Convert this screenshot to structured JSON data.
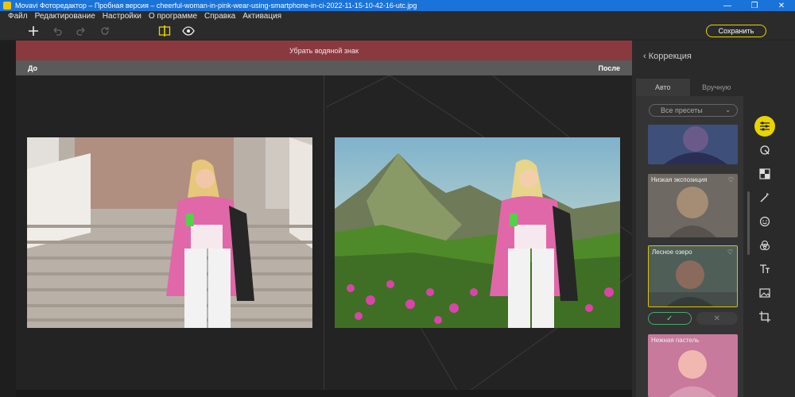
{
  "window": {
    "title": "Movavi Фоторедактор – Пробная версия – cheerful-woman-in-pink-wear-using-smartphone-in-ci-2022-11-15-10-42-16-utc.jpg",
    "minimize": "—",
    "maximize": "❐",
    "close": "✕"
  },
  "menu": [
    "Файл",
    "Редактирование",
    "Настройки",
    "О программе",
    "Справка",
    "Активация"
  ],
  "toolbar": {
    "save_label": "Сохранить"
  },
  "banner": {
    "text": "Убрать водяной знак"
  },
  "compare": {
    "before_label": "До",
    "after_label": "После"
  },
  "panel": {
    "header": "Коррекция",
    "tabs": [
      {
        "label": "Авто",
        "active": true
      },
      {
        "label": "Вручную",
        "active": false
      }
    ],
    "preset_select": "Все пресеты",
    "presets": [
      {
        "label": ""
      },
      {
        "label": "Низкая экспозиция"
      },
      {
        "label": "Лесное озеро"
      },
      {
        "label": "Нежная пастель"
      }
    ],
    "apply_symbol": "✓",
    "cancel_symbol": "✕"
  },
  "colors": {
    "accent": "#e8d400",
    "banner": "#8a3a3f",
    "titlebar": "#1a73d8"
  }
}
